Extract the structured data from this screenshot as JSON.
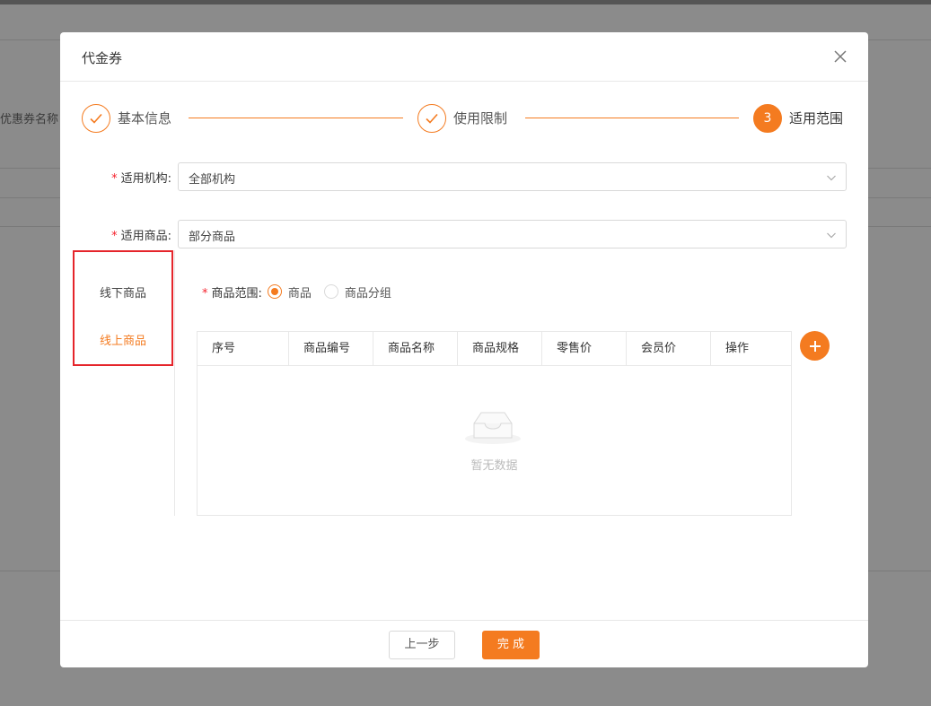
{
  "background": {
    "coupon_name_label": "优惠券名称"
  },
  "modal": {
    "title": "代金券",
    "close_icon": "close-icon"
  },
  "steps": [
    {
      "label": "基本信息",
      "status": "done",
      "marker": ""
    },
    {
      "label": "使用限制",
      "status": "done",
      "marker": ""
    },
    {
      "label": "适用范围",
      "status": "active",
      "marker": "3"
    }
  ],
  "form": {
    "institution": {
      "label": "适用机构:",
      "value": "全部机构",
      "required": true
    },
    "products": {
      "label": "适用商品:",
      "value": "部分商品",
      "required": true
    }
  },
  "left_tabs": [
    {
      "label": "线下商品",
      "active": false
    },
    {
      "label": "线上商品",
      "active": true
    }
  ],
  "scope": {
    "label": "商品范围:",
    "required": true,
    "options": [
      {
        "label": "商品",
        "checked": true
      },
      {
        "label": "商品分组",
        "checked": false
      }
    ]
  },
  "table": {
    "columns": [
      "序号",
      "商品编号",
      "商品名称",
      "商品规格",
      "零售价",
      "会员价",
      "操作"
    ],
    "rows": [],
    "empty_text": "暂无数据"
  },
  "footer": {
    "prev_label": "上一步",
    "done_label": "完 成"
  },
  "colors": {
    "accent": "#f47b20",
    "required": "#f5222d",
    "highlight_box": "#e5252b"
  }
}
